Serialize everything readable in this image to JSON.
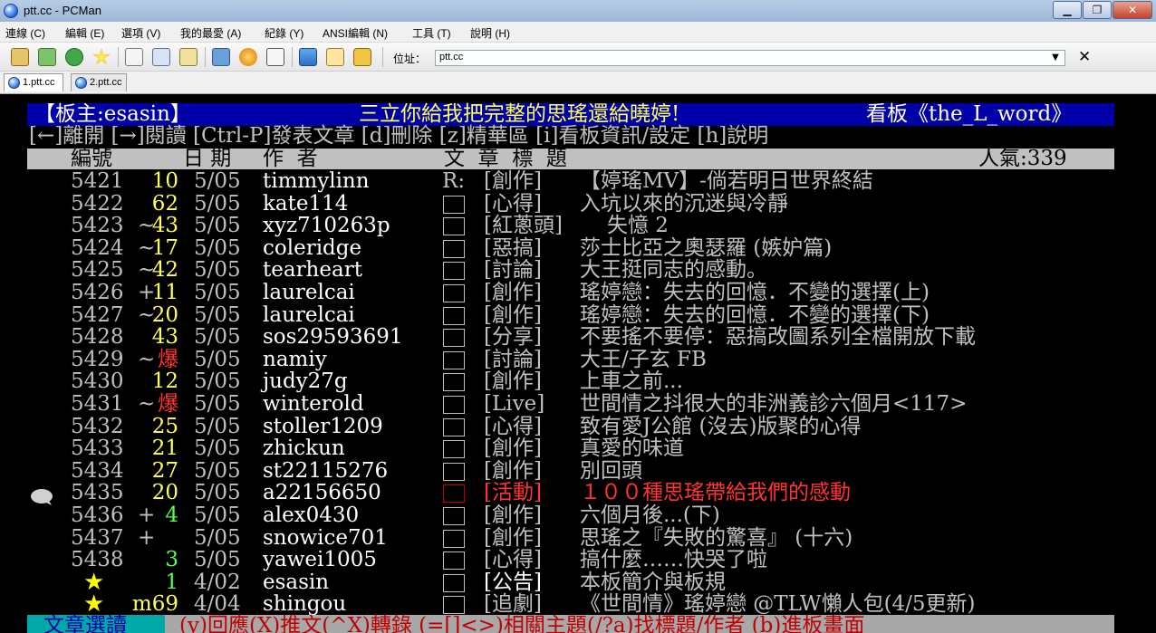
{
  "window": {
    "title": "ptt.cc - PCMan",
    "min": "▁",
    "max": "❐",
    "close": "✕"
  },
  "menu": [
    "連線 (C)",
    "編輯 (E)",
    "選項 (V)",
    "我的最愛 (A)",
    "紀錄 (Y)",
    "ANSI編輯 (N)",
    "工具 (T)",
    "說明 (H)"
  ],
  "toolbar": {
    "address_label": "位址：",
    "address_value": "ptt.cc",
    "dropdown": "▼",
    "clear": "✕"
  },
  "tabs": [
    {
      "label": "1.ptt.cc"
    },
    {
      "label": "2.ptt.cc"
    }
  ],
  "board": {
    "moderator": "【板主:esasin】",
    "banner": "三立你給我把完整的思瑤還給曉婷!",
    "board_name": "看板《the_L_word》",
    "commands": "[←]離開 [→]閱讀 [Ctrl-P]發表文章 [d]刪除 [z]精華區 [i]看板資訊/設定 [h]說明",
    "col_no": "編號",
    "col_date": "日 期",
    "col_author": "作  者",
    "col_title": "文  章  標  題",
    "popularity": "人氣:339"
  },
  "posts": [
    {
      "no": "5421",
      "flag": "",
      "push": "10",
      "pushcolor": "yellow",
      "date": "5/05",
      "author": "timmylinn",
      "mark": "R:",
      "cat": "[創作]",
      "title": "【婷瑤MV】-倘若明日世界終結",
      "titlecolor": "gray"
    },
    {
      "no": "5422",
      "flag": "",
      "push": "62",
      "pushcolor": "yellow",
      "date": "5/05",
      "author": "kate114",
      "mark": "□",
      "cat": "[心得]",
      "title": "入坑以來的沉迷與冷靜",
      "titlecolor": "gray"
    },
    {
      "no": "5423",
      "flag": "~",
      "push": "43",
      "pushcolor": "yellow",
      "date": "5/05",
      "author": "xyz710263p",
      "mark": "□",
      "cat": "[紅蔥頭]",
      "title": "失憶 2",
      "titlecolor": "gray"
    },
    {
      "no": "5424",
      "flag": "~",
      "push": "17",
      "pushcolor": "yellow",
      "date": "5/05",
      "author": "coleridge",
      "mark": "□",
      "cat": "[惡搞]",
      "title": "莎士比亞之奧瑟羅 (嫉妒篇)",
      "titlecolor": "gray"
    },
    {
      "no": "5425",
      "flag": "~",
      "push": "42",
      "pushcolor": "yellow",
      "date": "5/05",
      "author": "tearheart",
      "mark": "□",
      "cat": "[討論]",
      "title": "大王挺同志的感動。",
      "titlecolor": "gray"
    },
    {
      "no": "5426",
      "flag": "+",
      "push": "11",
      "pushcolor": "yellow",
      "date": "5/05",
      "author": "laurelcai",
      "mark": "□",
      "cat": "[創作]",
      "title": "瑤婷戀：失去的回憶．不變的選擇(上)",
      "titlecolor": "gray"
    },
    {
      "no": "5427",
      "flag": "~",
      "push": "20",
      "pushcolor": "yellow",
      "date": "5/05",
      "author": "laurelcai",
      "mark": "□",
      "cat": "[創作]",
      "title": "瑤婷戀：失去的回憶．不變的選擇(下)",
      "titlecolor": "gray"
    },
    {
      "no": "5428",
      "flag": "",
      "push": "43",
      "pushcolor": "yellow",
      "date": "5/05",
      "author": "sos29593691",
      "mark": "□",
      "cat": "[分享]",
      "title": "不要搖不要停：惡搞改圖系列全檔開放下載",
      "titlecolor": "gray"
    },
    {
      "no": "5429",
      "flag": "~",
      "push": "爆",
      "pushcolor": "red",
      "date": "5/05",
      "author": "namiy",
      "mark": "□",
      "cat": "[討論]",
      "title": "大王/子玄 FB",
      "titlecolor": "gray"
    },
    {
      "no": "5430",
      "flag": "",
      "push": "12",
      "pushcolor": "yellow",
      "date": "5/05",
      "author": "judy27g",
      "mark": "□",
      "cat": "[創作]",
      "title": "上車之前...",
      "titlecolor": "gray"
    },
    {
      "no": "5431",
      "flag": "~",
      "push": "爆",
      "pushcolor": "red",
      "date": "5/05",
      "author": "winterold",
      "mark": "□",
      "cat": "[Live]",
      "title": "世間情之抖很大的非洲義診六個月<117>",
      "titlecolor": "gray"
    },
    {
      "no": "5432",
      "flag": "",
      "push": "25",
      "pushcolor": "yellow",
      "date": "5/05",
      "author": "stoller1209",
      "mark": "□",
      "cat": "[心得]",
      "title": "致有愛J公館 (沒去)版聚的心得",
      "titlecolor": "gray"
    },
    {
      "no": "5433",
      "flag": "",
      "push": "21",
      "pushcolor": "yellow",
      "date": "5/05",
      "author": "zhickun",
      "mark": "□",
      "cat": "[創作]",
      "title": "真愛的味道",
      "titlecolor": "gray"
    },
    {
      "no": "5434",
      "flag": "",
      "push": "27",
      "pushcolor": "yellow",
      "date": "5/05",
      "author": "st22115276",
      "mark": "□",
      "cat": "[創作]",
      "title": "別回頭",
      "titlecolor": "gray"
    },
    {
      "no": "5435",
      "flag": "",
      "push": "20",
      "pushcolor": "yellow",
      "date": "5/05",
      "author": "a22156650",
      "mark": "□",
      "cat": "[活動]",
      "title": "１００種思瑤帶給我們的感動",
      "titlecolor": "red"
    },
    {
      "no": "5436",
      "flag": "+",
      "push": "4",
      "pushcolor": "green",
      "date": "5/05",
      "author": "alex0430",
      "mark": "□",
      "cat": "[創作]",
      "title": "六個月後...(下)",
      "titlecolor": "gray"
    },
    {
      "no": "5437",
      "flag": "+",
      "push": "",
      "pushcolor": "yellow",
      "date": "5/05",
      "author": "snowice701",
      "mark": "□",
      "cat": "[創作]",
      "title": "思瑤之『失敗的驚喜』 (十六)",
      "titlecolor": "gray"
    },
    {
      "no": "5438",
      "flag": "",
      "push": "3",
      "pushcolor": "green",
      "date": "5/05",
      "author": "yawei1005",
      "mark": "□",
      "cat": "[心得]",
      "title": "搞什麼……快哭了啦",
      "titlecolor": "gray"
    },
    {
      "no": "★",
      "flag": "",
      "push": "1",
      "pushcolor": "green",
      "date": "4/02",
      "author": "esasin",
      "mark": "□",
      "cat": "[公告]",
      "title": "本板簡介與板規",
      "titlecolor": "gray"
    },
    {
      "no": "★",
      "flag": "",
      "push": "m69",
      "pushcolor": "yellow",
      "date": "4/04",
      "author": "shingou",
      "mark": "□",
      "cat": "[追劇]",
      "title": "《世間情》瑤婷戀 @TLW懶人包(4/5更新)",
      "titlecolor": "gray"
    }
  ],
  "footer": {
    "mode": "文章選讀",
    "hint": "(y)回應(X)推文(^X)轉錄 (=[]<>)相關主題(/?a)找標題/作者 (b)進板畫面"
  },
  "colors": {
    "term_bg": "#000000",
    "header_blue": "#0000a8",
    "yellow": "#ffff55",
    "red": "#ff3333",
    "green": "#55ff55"
  }
}
